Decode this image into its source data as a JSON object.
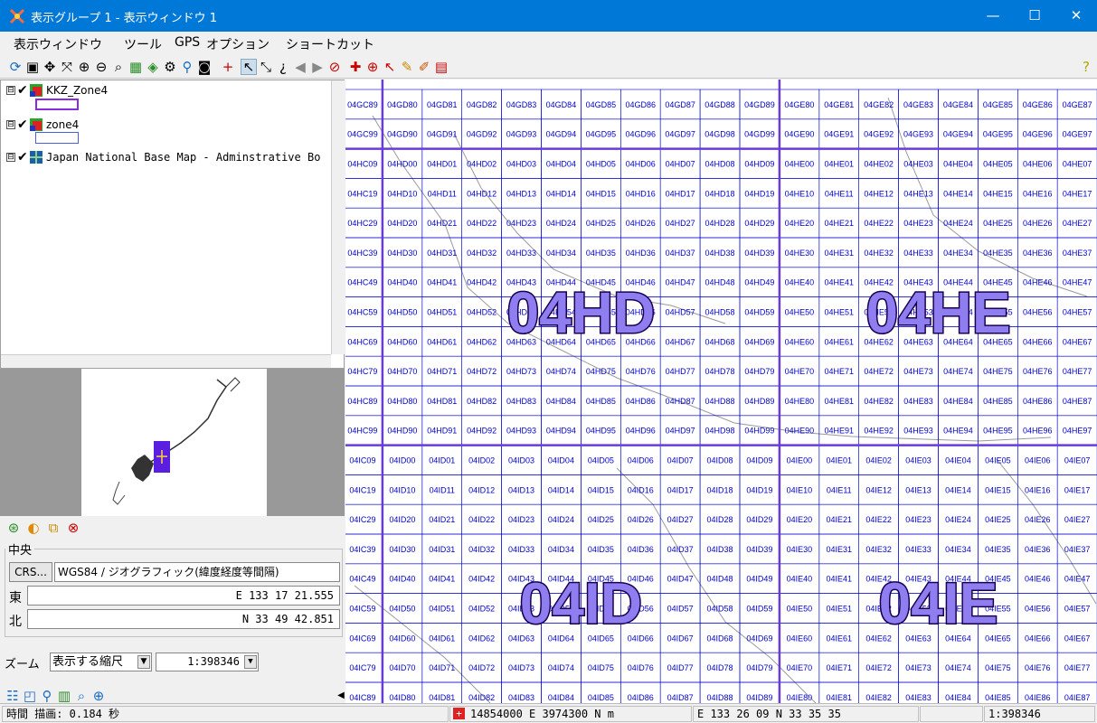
{
  "window": {
    "title": "表示グループ 1  - 表示ウィンドウ 1",
    "minimize": "—",
    "maximize": "☐",
    "close": "✕"
  },
  "menu": [
    "表示ウィンドウ",
    "ツール",
    "GPS",
    "オプション",
    "ショートカット"
  ],
  "toolbar": {
    "help": "?"
  },
  "layers": [
    {
      "name": "KKZ_Zone4",
      "expander": "⊟",
      "check": "✔",
      "icon": "layer-stack-icon",
      "swatch": "#8a2be2"
    },
    {
      "name": "zone4",
      "expander": "⊟",
      "check": "✔",
      "icon": "layer-stack-icon",
      "swatch": "#4a5fe0"
    },
    {
      "name": "Japan National Base Map - Adminstrative Bo",
      "expander": "⊟",
      "check": "✔",
      "icon": "raster-grid-icon"
    }
  ],
  "center": {
    "legend": "中央",
    "crs_button": "CRS...",
    "crs_value": "WGS84 / ジオグラフィック(緯度経度等間隔)",
    "east_label": "東",
    "east_value": "E 133 17 21.555",
    "north_label": "北",
    "north_value": "N 33 49 42.851"
  },
  "zoom": {
    "label": "ズーム",
    "mode": "表示する縮尺",
    "scale": "1:398346",
    "dropdown": "▼"
  },
  "status": {
    "time": "時間 描画: 0.184 秒",
    "projected": "14854000 E   3974300 N m",
    "geographic": "E 133 26 09   N 33 35 35",
    "scale": "1:398346"
  },
  "map": {
    "grid_color": "#0000cc",
    "label_color": "#0000cc",
    "big_label_fill": "#8f7ef0",
    "big_label_stroke": "#1a0050",
    "columns": [
      "C9",
      "D0",
      "D1",
      "D2",
      "D3",
      "D4",
      "D5",
      "D6",
      "D7",
      "D8",
      "D9",
      "E0",
      "E1",
      "E2",
      "E3",
      "E4",
      "E5",
      "E6",
      "E7"
    ],
    "rows": [
      "04G8",
      "04G9",
      "04H0",
      "04H1",
      "04H2",
      "04H3",
      "04H4",
      "04H5",
      "04H6",
      "04H7",
      "04H8",
      "04H9",
      "04I0",
      "04I1",
      "04I2",
      "04I3",
      "04I4",
      "04I5",
      "04I6",
      "04I7",
      "04I8"
    ],
    "big_labels": [
      "04HD",
      "04HE",
      "04ID",
      "04IE"
    ]
  }
}
